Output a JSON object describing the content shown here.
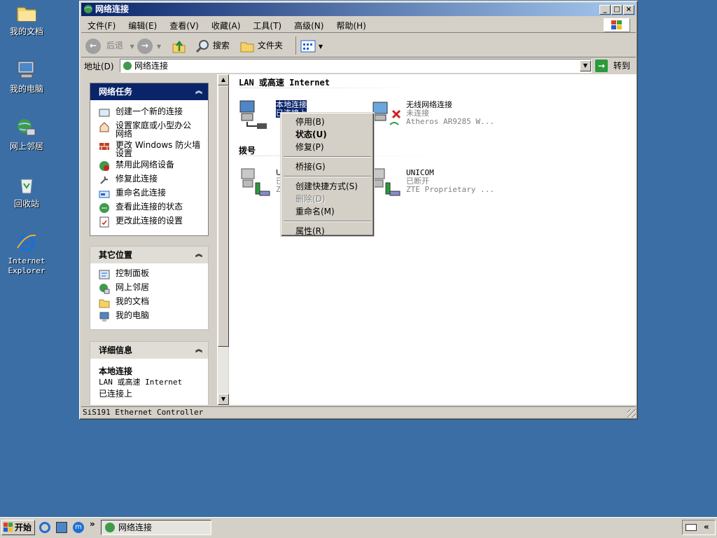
{
  "desktop": {
    "icons": [
      {
        "label": "我的文档",
        "icon": "folder-icon"
      },
      {
        "label": "我的电脑",
        "icon": "computer-icon"
      },
      {
        "label": "网上邻居",
        "icon": "network-icon"
      },
      {
        "label": "回收站",
        "icon": "recycle-bin-icon"
      },
      {
        "label": "Internet Explorer",
        "icon": "ie-icon"
      }
    ]
  },
  "window": {
    "title": "网络连接",
    "menu": [
      "文件(F)",
      "编辑(E)",
      "查看(V)",
      "收藏(A)",
      "工具(T)",
      "高级(N)",
      "帮助(H)"
    ],
    "toolbar": {
      "back": "后退",
      "search": "搜索",
      "folders": "文件夹"
    },
    "address": {
      "label": "地址(D)",
      "value": "网络连接",
      "go": "转到"
    }
  },
  "left_panel": {
    "network_tasks": {
      "title": "网络任务",
      "items": [
        "创建一个新的连接",
        "设置家庭或小型办公网络",
        "更改 Windows 防火墙设置",
        "禁用此网络设备",
        "修复此连接",
        "重命名此连接",
        "查看此连接的状态",
        "更改此连接的设置"
      ]
    },
    "other_places": {
      "title": "其它位置",
      "items": [
        "控制面板",
        "网上邻居",
        "我的文档",
        "我的电脑"
      ]
    },
    "details": {
      "title": "详细信息",
      "name": "本地连接",
      "type": "LAN 或高速 Internet",
      "status": "已连接上"
    }
  },
  "main": {
    "group_lan": "LAN 或高速 Internet",
    "group_dialup": "拨号",
    "lan_connections": [
      {
        "name": "本地连接",
        "status": "已连接上",
        "device": ""
      },
      {
        "name": "无线网络连接",
        "status": "未连接",
        "device": "Atheros AR9285 W..."
      }
    ],
    "dialup_connections": [
      {
        "name": "U",
        "status": "已",
        "device": "Z"
      },
      {
        "name": "UNICOM",
        "status": "已断开",
        "device": "ZTE Proprietary ..."
      }
    ]
  },
  "context_menu": {
    "items": [
      "停用(B)",
      "状态(U)",
      "修复(P)",
      "桥接(G)",
      "创建快捷方式(S)",
      "删除(D)",
      "重命名(M)",
      "属性(R)"
    ]
  },
  "statusbar": {
    "text": "SiS191 Ethernet Controller"
  },
  "taskbar": {
    "start": "开始",
    "chevron": "»",
    "window": "网络连接",
    "tray_chevron": "«"
  },
  "colors": {
    "desktop": "#3a6ea5",
    "title_start": "#0a246a",
    "title_end": "#a6caf0",
    "selection": "#0a246a"
  }
}
